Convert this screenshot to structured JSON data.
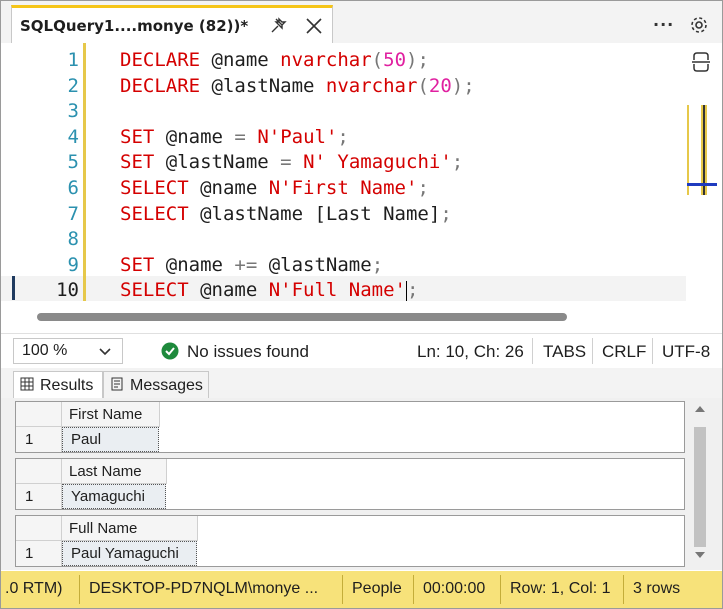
{
  "tab": {
    "title": "SQLQuery1....monye (82))*"
  },
  "toolbar": {
    "more": "···"
  },
  "editor": {
    "lines": [
      {
        "n": "1",
        "tokens": [
          [
            "kw",
            "DECLARE"
          ],
          [
            "var",
            " @name "
          ],
          [
            "kw",
            "nvarchar"
          ],
          [
            "pun",
            "("
          ],
          [
            "num",
            "50"
          ],
          [
            "pun",
            ");"
          ]
        ]
      },
      {
        "n": "2",
        "tokens": [
          [
            "kw",
            "DECLARE"
          ],
          [
            "var",
            " @lastName "
          ],
          [
            "kw",
            "nvarchar"
          ],
          [
            "pun",
            "("
          ],
          [
            "num",
            "20"
          ],
          [
            "pun",
            ");"
          ]
        ]
      },
      {
        "n": "3",
        "tokens": []
      },
      {
        "n": "4",
        "tokens": [
          [
            "kw",
            "SET"
          ],
          [
            "var",
            " @name "
          ],
          [
            "pun",
            "="
          ],
          [
            "var",
            " "
          ],
          [
            "str",
            "N'Paul'"
          ],
          [
            "pun",
            ";"
          ]
        ]
      },
      {
        "n": "5",
        "tokens": [
          [
            "kw",
            "SET"
          ],
          [
            "var",
            " @lastName "
          ],
          [
            "pun",
            "="
          ],
          [
            "var",
            " "
          ],
          [
            "str",
            "N' Yamaguchi'"
          ],
          [
            "pun",
            ";"
          ]
        ]
      },
      {
        "n": "6",
        "tokens": [
          [
            "kw",
            "SELECT"
          ],
          [
            "var",
            " @name "
          ],
          [
            "str",
            "N'First Name'"
          ],
          [
            "pun",
            ";"
          ]
        ]
      },
      {
        "n": "7",
        "tokens": [
          [
            "kw",
            "SELECT"
          ],
          [
            "var",
            " @lastName [Last Name]"
          ],
          [
            "pun",
            ";"
          ]
        ]
      },
      {
        "n": "8",
        "tokens": []
      },
      {
        "n": "9",
        "tokens": [
          [
            "kw",
            "SET"
          ],
          [
            "var",
            " @name "
          ],
          [
            "pun",
            "+="
          ],
          [
            "var",
            " @lastName"
          ],
          [
            "pun",
            ";"
          ]
        ]
      },
      {
        "n": "10",
        "tokens": [
          [
            "kw",
            "SELECT"
          ],
          [
            "var",
            " @name "
          ],
          [
            "str",
            "N'Full Name'"
          ],
          [
            "pun",
            ";"
          ]
        ]
      }
    ],
    "current_line": 10
  },
  "status": {
    "zoom": "100 %",
    "issues": "No issues found",
    "position": "Ln: 10, Ch: 26",
    "indent": "TABS",
    "line_ending": "CRLF",
    "encoding": "UTF-8"
  },
  "result_tabs": {
    "results": "Results",
    "messages": "Messages"
  },
  "grids": [
    {
      "column": "First Name",
      "row_num": "1",
      "value": "Paul"
    },
    {
      "column": "Last Name",
      "row_num": "1",
      "value": " Yamaguchi"
    },
    {
      "column": "Full Name",
      "row_num": "1",
      "value": "Paul Yamaguchi"
    }
  ],
  "statusbar": {
    "version": ".0 RTM)",
    "server": "DESKTOP-PD7NQLM\\monye ...",
    "database": "People",
    "elapsed": "00:00:00",
    "rowcol": "Row: 1, Col: 1",
    "rows": "3 rows"
  },
  "colors": {
    "accent_yellow": "#f5c518",
    "status_bar": "#f7e27a",
    "keyword": "#d40000",
    "number": "#e020a0",
    "line_number": "#2b91af"
  }
}
